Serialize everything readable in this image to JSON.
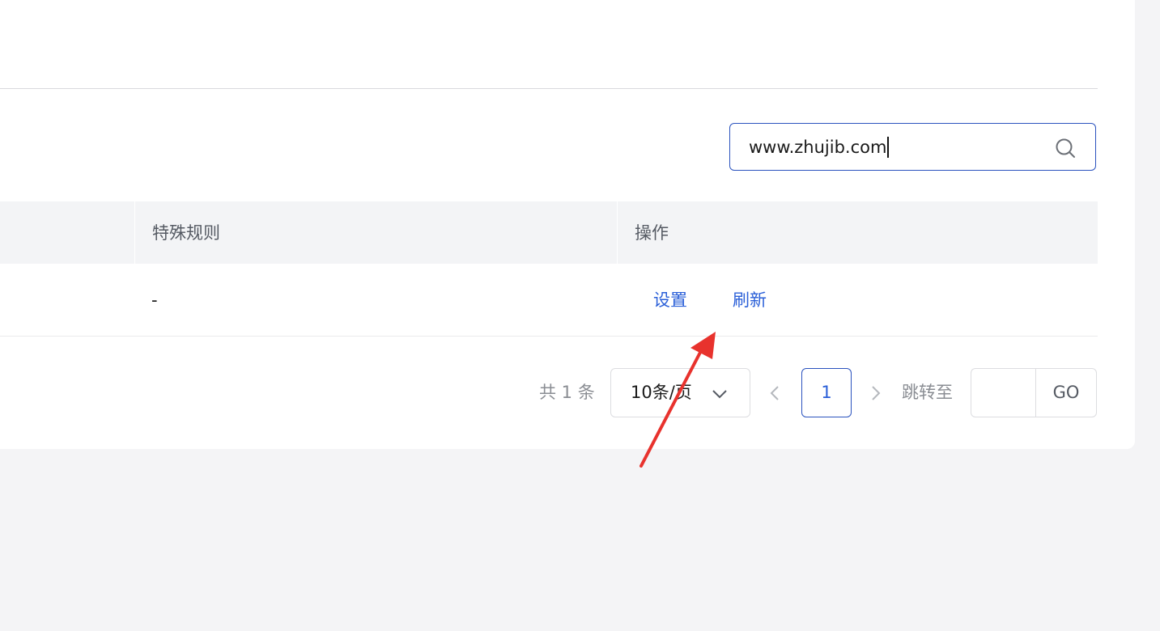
{
  "search": {
    "value": "www.zhujib.com",
    "icon": "search-icon"
  },
  "table": {
    "headers": [
      "特殊规则",
      "操作"
    ],
    "rows": [
      {
        "special_rule": "-",
        "actions": [
          "设置",
          "刷新"
        ]
      }
    ]
  },
  "pagination": {
    "total_label": "共 1 条",
    "page_size_label": "10条/页",
    "current_page": "1",
    "jump_label": "跳转至",
    "jump_value": "",
    "go_label": "GO"
  },
  "colors": {
    "accent": "#2a5fd8",
    "arrow": "#e8322d",
    "header_bg": "#f3f4f6",
    "page_bg": "#f4f4f6"
  }
}
